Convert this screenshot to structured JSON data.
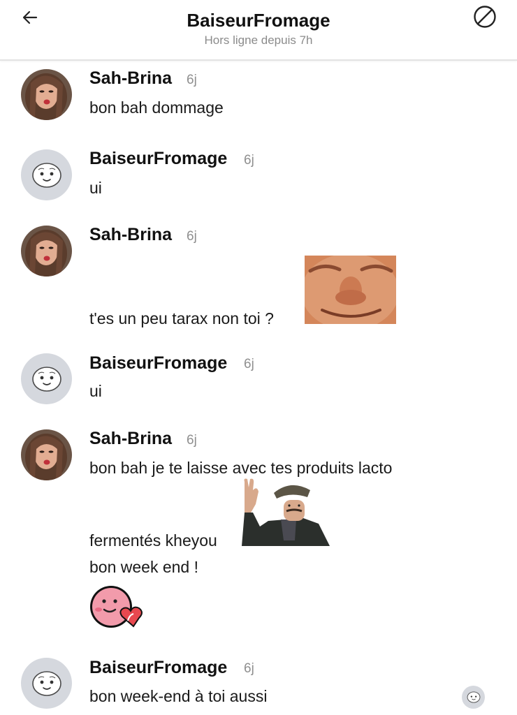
{
  "header": {
    "title": "BaiseurFromage",
    "status": "Hors ligne depuis 7h",
    "back_icon": "arrow-left-icon",
    "block_icon": "block-icon"
  },
  "messages": [
    {
      "author": "Sah-Brina",
      "time": "6j",
      "lines": [
        "bon bah dommage"
      ]
    },
    {
      "author": "BaiseurFromage",
      "time": "6j",
      "lines": [
        "ui"
      ]
    },
    {
      "author": "Sah-Brina",
      "time": "6j",
      "lines": [
        "t'es un peu tarax non toi ?"
      ],
      "sticker": "smiling-face-sticker"
    },
    {
      "author": "BaiseurFromage",
      "time": "6j",
      "lines": [
        "ui"
      ]
    },
    {
      "author": "Sah-Brina",
      "time": "6j",
      "lines": [
        "bon bah je te laisse avec tes produits lacto",
        "fermentés kheyou",
        "bon week end !"
      ],
      "stickers": [
        "waving-man-sticker",
        "pink-heart-emoji-sticker"
      ]
    },
    {
      "author": "BaiseurFromage",
      "time": "6j",
      "lines": [
        "bon week-end à toi aussi"
      ]
    }
  ],
  "colors": {
    "default_avatar_bg": "#d5d8de",
    "time_text": "#8f8f8f",
    "status_text": "#8b8b8b",
    "emoji_pink": "#f29bab",
    "heart_red": "#e8484f"
  }
}
